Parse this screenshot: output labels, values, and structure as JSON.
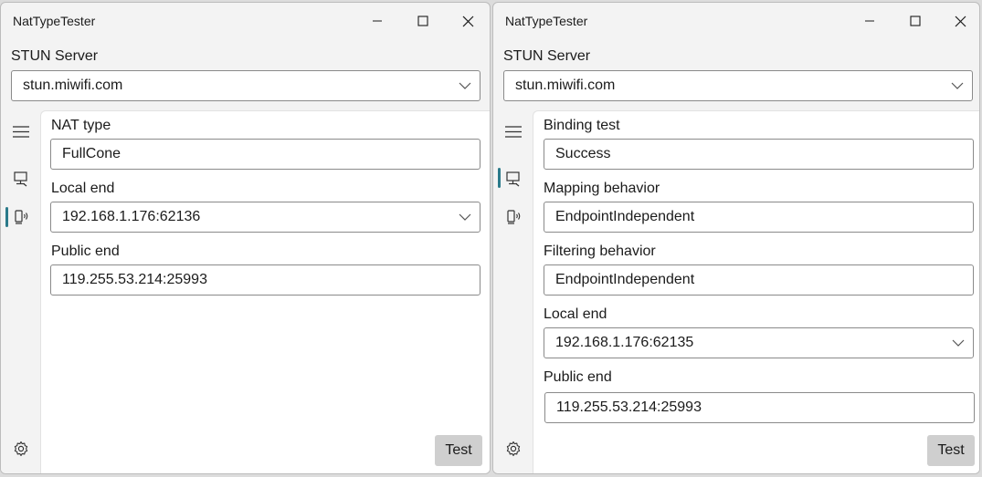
{
  "windows": [
    {
      "title": "NatTypeTester",
      "server_label": "STUN Server",
      "server_value": "stun.miwifi.com",
      "fields": [
        {
          "label": "NAT type",
          "value": "FullCone"
        },
        {
          "label": "Local end",
          "value": "192.168.1.176:62136"
        },
        {
          "label": "Public end",
          "value": "119.255.53.214:25993"
        }
      ],
      "test_label": "Test"
    },
    {
      "title": "NatTypeTester",
      "server_label": "STUN Server",
      "server_value": "stun.miwifi.com",
      "fields": [
        {
          "label": "Binding test",
          "value": "Success"
        },
        {
          "label": "Mapping behavior",
          "value": "EndpointIndependent"
        },
        {
          "label": "Filtering behavior",
          "value": "EndpointIndependent"
        },
        {
          "label": "Local end",
          "value": "192.168.1.176:62135"
        },
        {
          "label": "Public end",
          "value": "119.255.53.214:25993"
        }
      ],
      "test_label": "Test"
    }
  ],
  "icons": {
    "minimize": "minimize-icon",
    "maximize": "maximize-icon",
    "close": "close-icon",
    "menu": "hamburger-menu-icon",
    "rfc3489": "desktop-monitor-icon",
    "rfc5780": "phone-signal-icon",
    "settings": "gear-icon",
    "dropdown": "chevron-down-icon"
  },
  "colors": {
    "accent": "#2b7a8a",
    "button": "#cfcfcf"
  }
}
